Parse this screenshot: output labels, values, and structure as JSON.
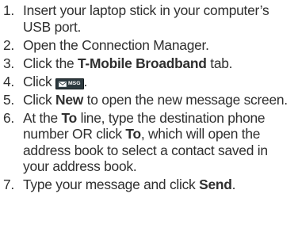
{
  "steps": [
    {
      "number": "1.",
      "text": "Insert your laptop stick in your computer’s USB port."
    },
    {
      "number": "2.",
      "text": "Open the Connection Manager."
    },
    {
      "number": "3.",
      "before": "Click the ",
      "bold": "T-Mobile Broadband",
      "after": " tab."
    },
    {
      "number": "4.",
      "before": "Click ",
      "button_label": "MSG",
      "button_icon": "envelope-icon",
      "after": "."
    },
    {
      "number": "5.",
      "before": "Click ",
      "bold": "New",
      "after": " to open the new message screen."
    },
    {
      "number": "6.",
      "before": "At the ",
      "bold1": "To",
      "middle": " line, type the destination phone number OR click ",
      "bold2": "To",
      "after": ", which will open the address book to select a contact saved in your address book."
    },
    {
      "number": "7.",
      "before": "Type your message and click ",
      "bold": "Send",
      "after": "."
    }
  ],
  "colors": {
    "text": "#2f2f2f",
    "button_background": "#2d3a3f",
    "button_text": "#ffffff"
  }
}
